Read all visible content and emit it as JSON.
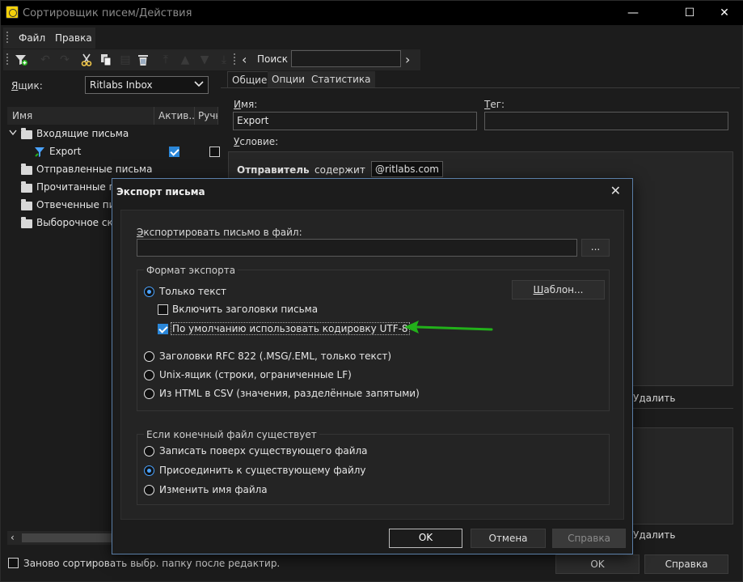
{
  "window": {
    "title": "Сортировщик писем/Действия",
    "minimize": "—",
    "maximize": "☐",
    "close": "✕"
  },
  "menu": {
    "file": "Файл",
    "edit": "Правка"
  },
  "toolbar": {
    "search_label": "Поиск",
    "search_value": ""
  },
  "left": {
    "mailbox_label": "Ящик:",
    "mailbox_value": "Ritlabs Inbox",
    "columns": [
      "Имя",
      "Актив...",
      "Ручн"
    ],
    "tree": [
      {
        "label": "Входящие письма",
        "expanded": true
      },
      {
        "label": "Export"
      },
      {
        "label": "Отправленные письма"
      },
      {
        "label": "Прочитанные пи"
      },
      {
        "label": "Отвеченные пись"
      },
      {
        "label": "Выборочное скач"
      }
    ],
    "export_active": true,
    "export_manual": false,
    "resort_label": "Заново сортировать выбр. папку после редактир.",
    "resort_checked": false
  },
  "right": {
    "tabs": [
      "Общие",
      "Опции",
      "Статистика"
    ],
    "name_label": "Имя:",
    "name_value": "Export",
    "tag_label": "Тег:",
    "tag_value": "",
    "condition_label": "Условие:",
    "condition_field": "Отправитель",
    "condition_op": "содержит",
    "condition_value": "@ritlabs.com",
    "delete_label_1": "Удалить",
    "delete_label_2": "Удалить"
  },
  "bottom": {
    "ok": "OK",
    "help": "Справка"
  },
  "dialog": {
    "title": "Экспорт письма",
    "close": "✕",
    "file_label": "Экспортировать письмо в файл:",
    "file_value": "",
    "browse": "...",
    "format_group": "Формат экспорта",
    "template_button": "Шаблон...",
    "formats": [
      {
        "label": "Только текст",
        "checked": true
      },
      {
        "label": "Заголовки RFC 822 (.MSG/.EML, только текст)",
        "checked": false
      },
      {
        "label": "Unix-ящик (строки, ограниченные LF)",
        "checked": false
      },
      {
        "label": "Из HTML в CSV (значения, разделённые запятыми)",
        "checked": false
      }
    ],
    "include_headers": {
      "label": "Включить заголовки письма",
      "checked": false
    },
    "utf8_default": {
      "label": "По умолчанию использовать кодировку UTF-8",
      "checked": true
    },
    "exists_group": "Если конечный файл существует",
    "exists_options": [
      {
        "label": "Записать поверх существующего файла",
        "checked": false
      },
      {
        "label": "Присоединить к существующему файлу",
        "checked": true
      },
      {
        "label": "Изменить имя файла",
        "checked": false
      }
    ],
    "ok": "OK",
    "cancel": "Отмена",
    "help": "Справка"
  },
  "colors": {
    "accent": "#2a86d8",
    "arrow": "#22b01a",
    "dialog_border": "#5b7fa8"
  }
}
